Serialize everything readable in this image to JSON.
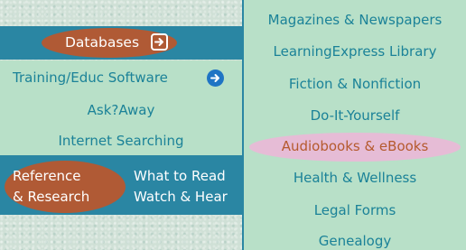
{
  "left_menu": {
    "databases": {
      "label": "Databases",
      "icon": "arrow-right-square-icon"
    },
    "items": [
      {
        "label": "Training/Educ Software",
        "icon": "arrow-right-circle-icon"
      },
      {
        "label": "Ask?Away"
      },
      {
        "label": "Internet Searching"
      }
    ],
    "reference": {
      "line1": "Reference",
      "line2": "& Research"
    },
    "truncated_links": [
      "What to Read",
      "Watch & Hear"
    ]
  },
  "dropdown": {
    "items": [
      "Magazines & Newspapers",
      "LearningExpress Library",
      "Fiction & Nonfiction",
      "Do-It-Yourself",
      "Audiobooks & eBooks",
      "Health & Wellness",
      "Legal Forms",
      "Genealogy"
    ],
    "highlighted": "Audiobooks & eBooks"
  },
  "colors": {
    "bar_blue": "#2a86a3",
    "pill_rust": "#b05a35",
    "text_teal": "#1b8298",
    "panel_green": "#b8e0c8",
    "highlight_pink": "#e6bcd6"
  }
}
